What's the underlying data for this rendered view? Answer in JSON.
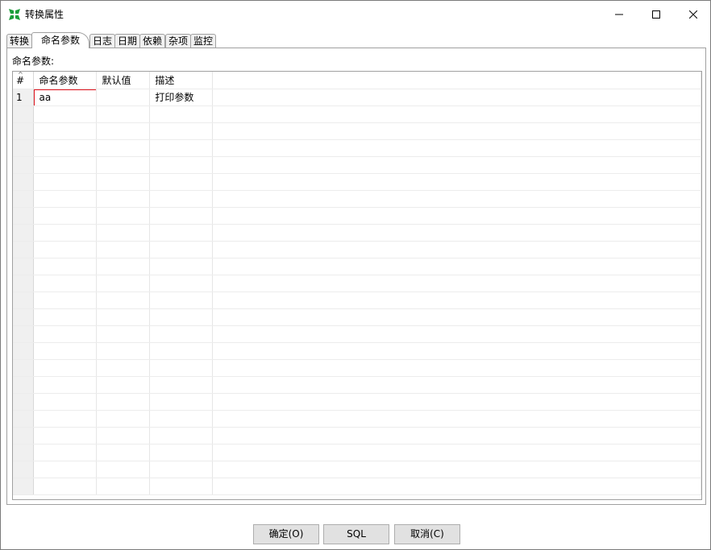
{
  "window": {
    "title": "转换属性",
    "app_icon": "kettle-spoon-icon",
    "controls": [
      "minimize-icon",
      "maximize-icon",
      "close-icon"
    ]
  },
  "tabs": [
    {
      "label": "转换",
      "active": false
    },
    {
      "label": "命名参数",
      "active": true
    },
    {
      "label": "日志",
      "active": false
    },
    {
      "label": "日期",
      "active": false
    },
    {
      "label": "依赖",
      "active": false
    },
    {
      "label": "杂项",
      "active": false
    },
    {
      "label": "监控",
      "active": false
    }
  ],
  "params_section": {
    "label": "命名参数:",
    "columns": [
      "#",
      "命名参数",
      "默认值",
      "描述"
    ],
    "rows": [
      {
        "num": "1",
        "name": "aa",
        "default": "",
        "description": "打印参数"
      }
    ],
    "highlight_color": "#e0141e"
  },
  "buttons": {
    "ok": "确定(O)",
    "sql": "SQL",
    "cancel": "取消(C)"
  }
}
